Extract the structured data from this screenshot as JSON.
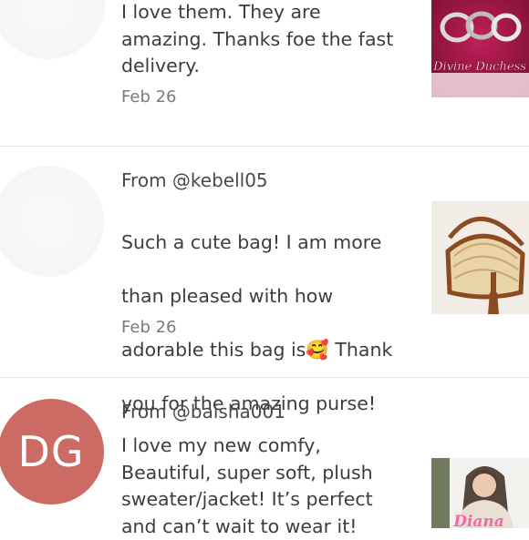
{
  "reviews": [
    {
      "from": "",
      "body": "I love them. They are\namazing. Thanks foe the fast\ndelivery.",
      "date": "Feb 26",
      "thumb_caption": "Divine Duchess"
    },
    {
      "from": "From @kebell05",
      "body_line1": "Such a cute bag! I am more",
      "body_line2": "than pleased with how",
      "body_line3a": "adorable this bag is",
      "emoji": "🥰",
      "body_line3b": " Thank",
      "body_line4": "you for the amazing purse!",
      "date": "Feb 26"
    },
    {
      "avatar_initials": "DG",
      "from": "From @baisha001",
      "body": "I love my new comfy,\nBeautiful, super soft, plush\nsweater/jacket! It’s perfect\nand can’t wait to wear it!",
      "thumb_caption": "Diana"
    }
  ]
}
